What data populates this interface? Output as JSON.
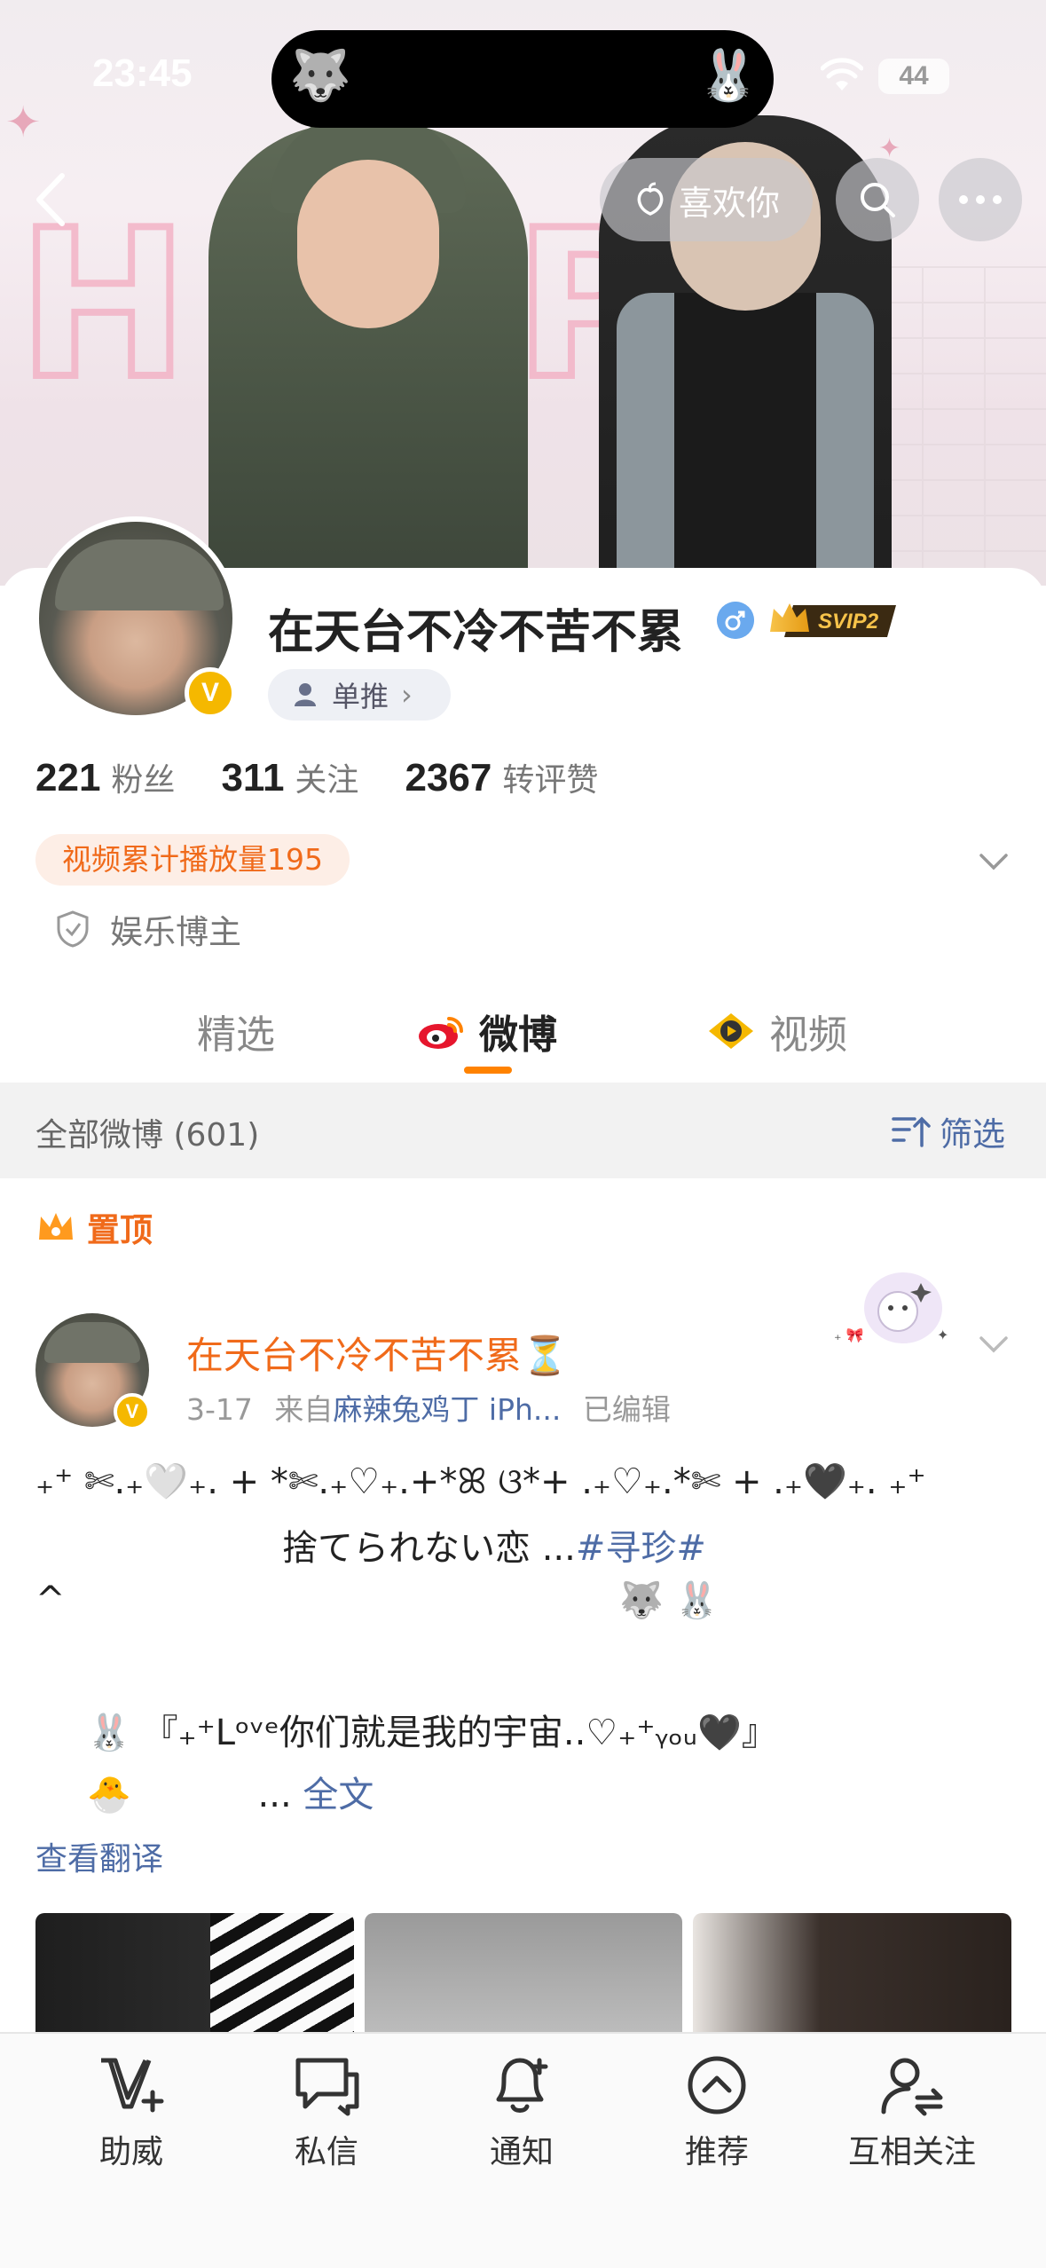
{
  "status_bar": {
    "time": "23:45",
    "battery": "44",
    "island_left_emoji": "🐺",
    "island_right_emoji": "🐰"
  },
  "nav": {
    "like_label": "喜欢你"
  },
  "profile": {
    "nickname": "在天台不冷不苦不累",
    "verified_badge": "V",
    "svip_label": "SVIP2",
    "single_push_label": "单推",
    "stats": [
      {
        "num": "221",
        "label": "粉丝"
      },
      {
        "num": "311",
        "label": "关注"
      },
      {
        "num": "2367",
        "label": "转评赞"
      }
    ],
    "play_count_tag": "视频累计播放量195",
    "role": "娱乐博主"
  },
  "tabs": [
    {
      "label": "精选"
    },
    {
      "label": "微博"
    },
    {
      "label": "视频"
    }
  ],
  "filter_bar": {
    "all_label": "全部微博 (601)",
    "filter_label": "筛选"
  },
  "post": {
    "pinned_label": "置顶",
    "author": "在天台不冷不苦不累⏳",
    "date": "3-17",
    "from_prefix": "来自",
    "source": "麻辣兔鸡丁 iPh...",
    "edited": "已编辑",
    "line1": "₊⁺ ✄.₊🤍₊. + *✄.₊♡₊.+*ꕤ ଓ*+ .₊♡₊.*✄ + .₊🖤₊. ₊⁺",
    "line2_text": "捨てられない恋 ...",
    "line2_topic": "#寻珍#",
    "line3_caret": "^",
    "line3_emoji": "🐺   🐰",
    "line4": "🐰 『₊⁺Lᵒᵛᵉ你们就是我的宇宙..♡₊⁺ᵧₒᵤ🖤』",
    "line5_emoji": "🐣",
    "line5_ellipsis": "...",
    "full_text_link": "全文",
    "translate_label": "查看翻译"
  },
  "tabbar": [
    {
      "label": "助威",
      "icon": "v-plus-icon"
    },
    {
      "label": "私信",
      "icon": "chat-bubble-icon"
    },
    {
      "label": "通知",
      "icon": "bell-plus-icon"
    },
    {
      "label": "推荐",
      "icon": "chevron-up-circle-icon"
    },
    {
      "label": "互相关注",
      "icon": "mutual-follow-icon"
    }
  ],
  "colors": {
    "accent_orange": "#ff8200",
    "link_blue": "#4e6ca6",
    "name_orange": "#f06a1a",
    "vip_gold": "#f5b800"
  }
}
